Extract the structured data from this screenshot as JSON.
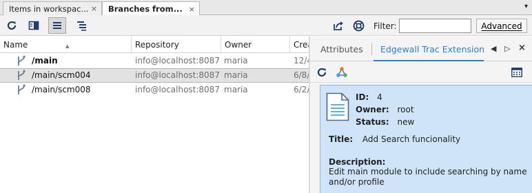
{
  "editor_tabs": [
    {
      "label": "Items in workspac...",
      "close": "×"
    },
    {
      "label": "Branches from...",
      "close": "×"
    }
  ],
  "tab_menu_glyph": "▾",
  "toolbar": {
    "filter_label": "Filter:",
    "filter_value": "",
    "advanced_label": "Advanced"
  },
  "table": {
    "columns": [
      "Name",
      "Repository",
      "Owner",
      "Crea"
    ],
    "rows": [
      {
        "name": "/main",
        "repository": "info@localhost:8087",
        "owner": "maria",
        "created": "12/4"
      },
      {
        "name": "/main/scm004",
        "repository": "info@localhost:8087",
        "owner": "maria",
        "created": "6/8/"
      },
      {
        "name": "/main/scm008",
        "repository": "info@localhost:8087",
        "owner": "maria",
        "created": "6/2/"
      }
    ],
    "selected_row": 1,
    "sorted_column": "Name"
  },
  "panel": {
    "tabs": [
      "Attributes",
      "Edgewall Trac Extension"
    ],
    "active_tab": "Edgewall Trac Extension",
    "nav": {
      "prev": "◀",
      "next": "▷",
      "close": "×"
    }
  },
  "ticket": {
    "id_label": "ID:",
    "id": "4",
    "owner_label": "Owner:",
    "owner": "root",
    "status_label": "Status:",
    "status": "new",
    "title_label": "Title:",
    "title": "Add Search funcionality",
    "description_label": "Description:",
    "description": "Edit main module to include searching by name and/or profile"
  },
  "colors": {
    "accent": "#2d7ec4",
    "ticket_bg": "#cfe4f9",
    "selection": "#e2e2e2"
  },
  "icons": {
    "toolbar": [
      "refresh-icon",
      "split-view-icon",
      "list-view-icon",
      "tree-view-icon"
    ],
    "toolbar_right": [
      "open-external-icon",
      "help-lifebuoy-icon"
    ],
    "panel": [
      "refresh-icon",
      "network-icon",
      "calendar-view-icon"
    ],
    "rows": "branch-icon",
    "ticket": "document-icon"
  }
}
